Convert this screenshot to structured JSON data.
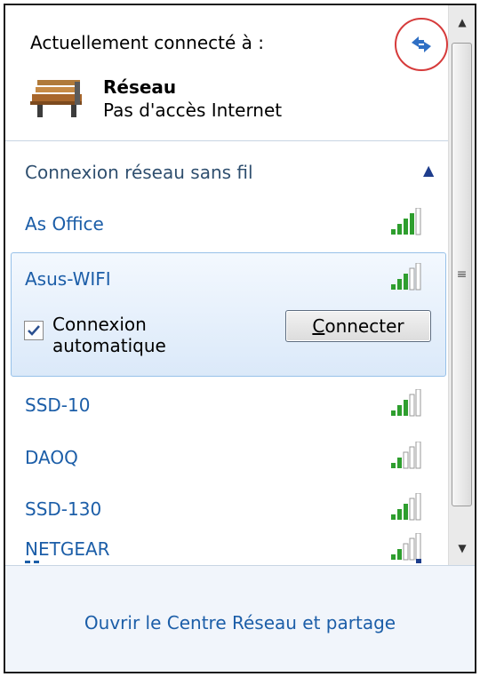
{
  "connected": {
    "header": "Actuellement connecté à :",
    "network_name": "Réseau",
    "network_status": "Pas d'accès Internet",
    "refresh_icon": "refresh-arrows-icon",
    "network_icon": "bench-network-icon"
  },
  "wireless": {
    "section_label": "Connexion réseau sans fil",
    "collapse_icon": "chevron-up-icon",
    "networks": [
      {
        "name": "As Office",
        "signal_bars": 4
      },
      {
        "name": "Asus-WIFI",
        "signal_bars": 3
      },
      {
        "name": "SSD-10",
        "signal_bars": 3
      },
      {
        "name": "DAOQ",
        "signal_bars": 2
      },
      {
        "name": "SSD-130",
        "signal_bars": 3
      },
      {
        "name": "NETGEAR",
        "signal_bars": 2
      }
    ],
    "selected": {
      "auto_connect_label_line1": "Connexion",
      "auto_connect_label_line2": "automatique",
      "auto_connect_checked": true,
      "connect_button_label": "onnecter",
      "connect_button_accel": "C"
    }
  },
  "footer": {
    "link": "Ouvrir le Centre Réseau et partage"
  },
  "colors": {
    "link": "#1c5ea8",
    "highlight_border": "#97c1e9",
    "signal_green": "#2e9e2e",
    "callout_red": "#d63b3b"
  }
}
